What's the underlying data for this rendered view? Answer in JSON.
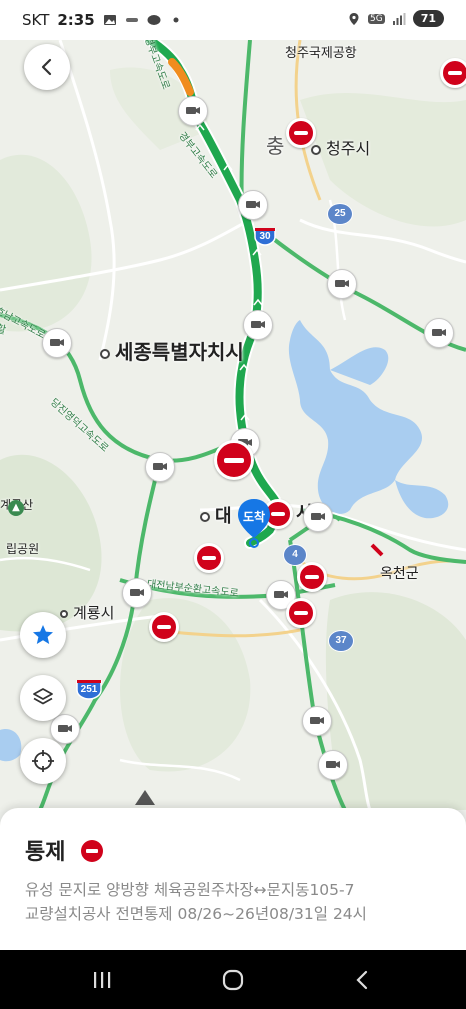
{
  "status_bar": {
    "carrier": "SKT",
    "time": "2:35",
    "network": "5G",
    "battery": "71"
  },
  "map": {
    "places": {
      "airport": "청주국제공항",
      "chungju_partial": "충",
      "cheongju": "청주시",
      "sejong": "세종특별자치시",
      "daejeon_left": "대",
      "daejeon_right": "시",
      "okcheon": "옥천군",
      "gyeryong": "계룡시",
      "park_top": "계룡산",
      "park_bottom": "립공원",
      "left_edge": "생활"
    },
    "road_labels": {
      "gyeongbu": "경부고속도로",
      "gyeongbu2": "경부고속도로",
      "dangjin": "당진영덕고속도로",
      "honam": "호남고속도로지선",
      "daejeon_ring": "대전남부순환고속도로"
    },
    "shields": {
      "r30": "30",
      "r25": "25",
      "r4": "4",
      "r37": "37",
      "r251": "251"
    },
    "destination_badge": "도착"
  },
  "controls": {
    "back": "back-arrow-icon",
    "favorite": "star-icon",
    "layers": "layers-icon",
    "locate": "crosshair-icon"
  },
  "sheet": {
    "title": "통제",
    "line1": "유성 문지로 양방향 체육공원주차장↔문지동105-7",
    "line2": "교량설치공사 전면통제 08/26~26년08/31일 24시"
  },
  "colors": {
    "route_green": "#1fa84f",
    "route_orange": "#f08c1e",
    "closure_red": "#d0021b",
    "accent_blue": "#1677e5",
    "water_blue": "#a9cdf0"
  }
}
